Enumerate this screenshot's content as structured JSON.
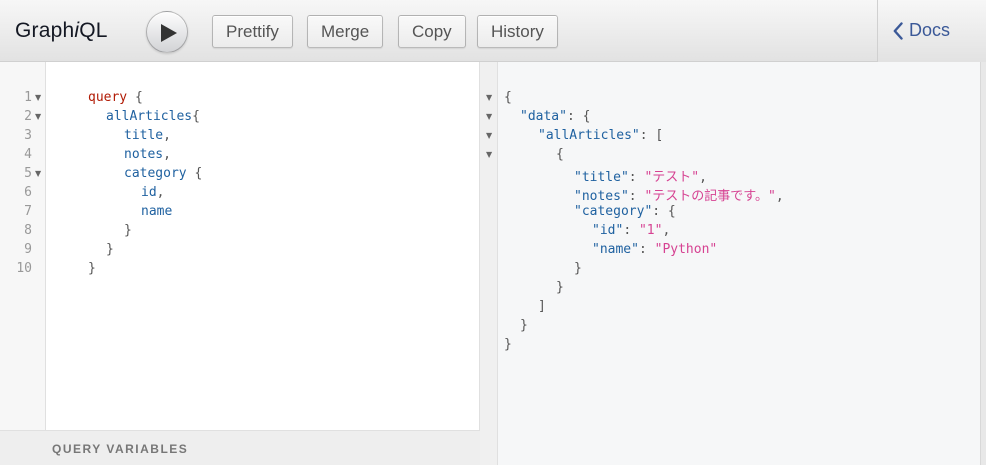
{
  "app": {
    "title_prefix": "Graph",
    "title_italic": "i",
    "title_suffix": "QL"
  },
  "toolbar": {
    "prettify": "Prettify",
    "merge": "Merge",
    "copy": "Copy",
    "history": "History",
    "docs": "Docs"
  },
  "editor": {
    "line_numbers": [
      "1",
      "2",
      "3",
      "4",
      "5",
      "6",
      "7",
      "8",
      "9",
      "10"
    ],
    "lines": [
      [
        "query",
        " {"
      ],
      [
        "allArticles",
        "{"
      ],
      [
        "title",
        ","
      ],
      [
        "notes",
        ","
      ],
      [
        "category",
        " {"
      ],
      [
        "id",
        ","
      ],
      [
        "name",
        ""
      ],
      [
        "",
        "}"
      ],
      [
        "",
        "}"
      ],
      [
        "",
        "}"
      ]
    ]
  },
  "variables": {
    "label": "QUERY VARIABLES"
  },
  "result": {
    "l1": "{",
    "data_key": "\"data\"",
    "l2_rest": ": {",
    "allArticles_key": "\"allArticles\"",
    "l3_rest": ": [",
    "l4": "{",
    "title_key": "\"title\"",
    "title_val": "\"テスト\"",
    "notes_key": "\"notes\"",
    "notes_val": "\"テストの記事です。\"",
    "category_key": "\"category\"",
    "l7_rest": ": {",
    "id_key": "\"id\"",
    "id_val": "\"1\"",
    "name_key": "\"name\"",
    "name_val": "\"Python\"",
    "l10": "}",
    "l11": "}",
    "l12": "]",
    "l13": "}",
    "l14": "}"
  }
}
